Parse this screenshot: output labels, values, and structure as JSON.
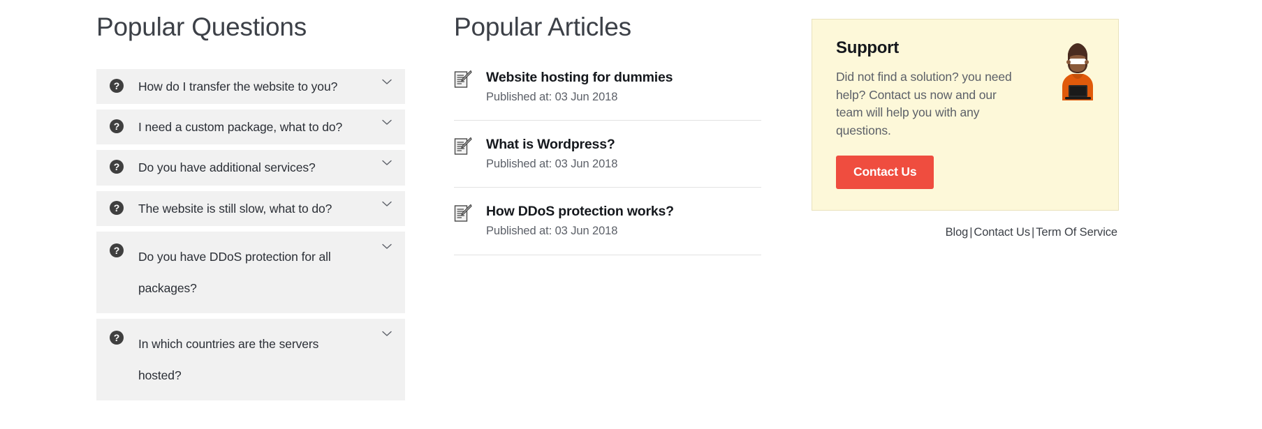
{
  "questions": {
    "heading": "Popular Questions",
    "icon_name": "question-mark-circle-icon",
    "toggle_icon_name": "chevron-down-icon",
    "items": [
      {
        "label": "How do I transfer the website to you?",
        "two_line": false
      },
      {
        "label": "I need a custom package, what to do?",
        "two_line": false
      },
      {
        "label": "Do you have additional services?",
        "two_line": false
      },
      {
        "label": "The website is still slow, what to do?",
        "two_line": false
      },
      {
        "label": "Do you have DDoS protection for all packages?",
        "two_line": true
      },
      {
        "label": "In which countries are the servers hosted?",
        "two_line": true
      }
    ]
  },
  "articles": {
    "heading": "Popular Articles",
    "icon_name": "memo-document-icon",
    "items": [
      {
        "title": "Website hosting for dummies",
        "meta": "Published at: 03 Jun 2018"
      },
      {
        "title": "What is Wordpress?",
        "meta": "Published at: 03 Jun 2018"
      },
      {
        "title": "How DDoS protection works?",
        "meta": "Published at: 03 Jun 2018"
      }
    ]
  },
  "support": {
    "title": "Support",
    "body": "Did not find a solution? you need help? Contact us now and our team will help you with any questions.",
    "button_label": "Contact Us",
    "illustration_name": "person-at-laptop-illustration",
    "card_bg": "#fdf8d9",
    "card_border": "#e9e2bc",
    "button_color": "#ef4d3f"
  },
  "footer": {
    "links": [
      {
        "label": "Blog"
      },
      {
        "label": "Contact Us"
      },
      {
        "label": "Term Of Service"
      }
    ],
    "separator": "|"
  },
  "colors": {
    "accordion_bg": "#f1f1f1",
    "heading": "#3c4047",
    "body_text": "#5c6068",
    "title_text": "#15181d",
    "divider": "#e2e2e2",
    "accent_red": "#ef4d3f",
    "icon_dark": "#3f3f3f"
  }
}
